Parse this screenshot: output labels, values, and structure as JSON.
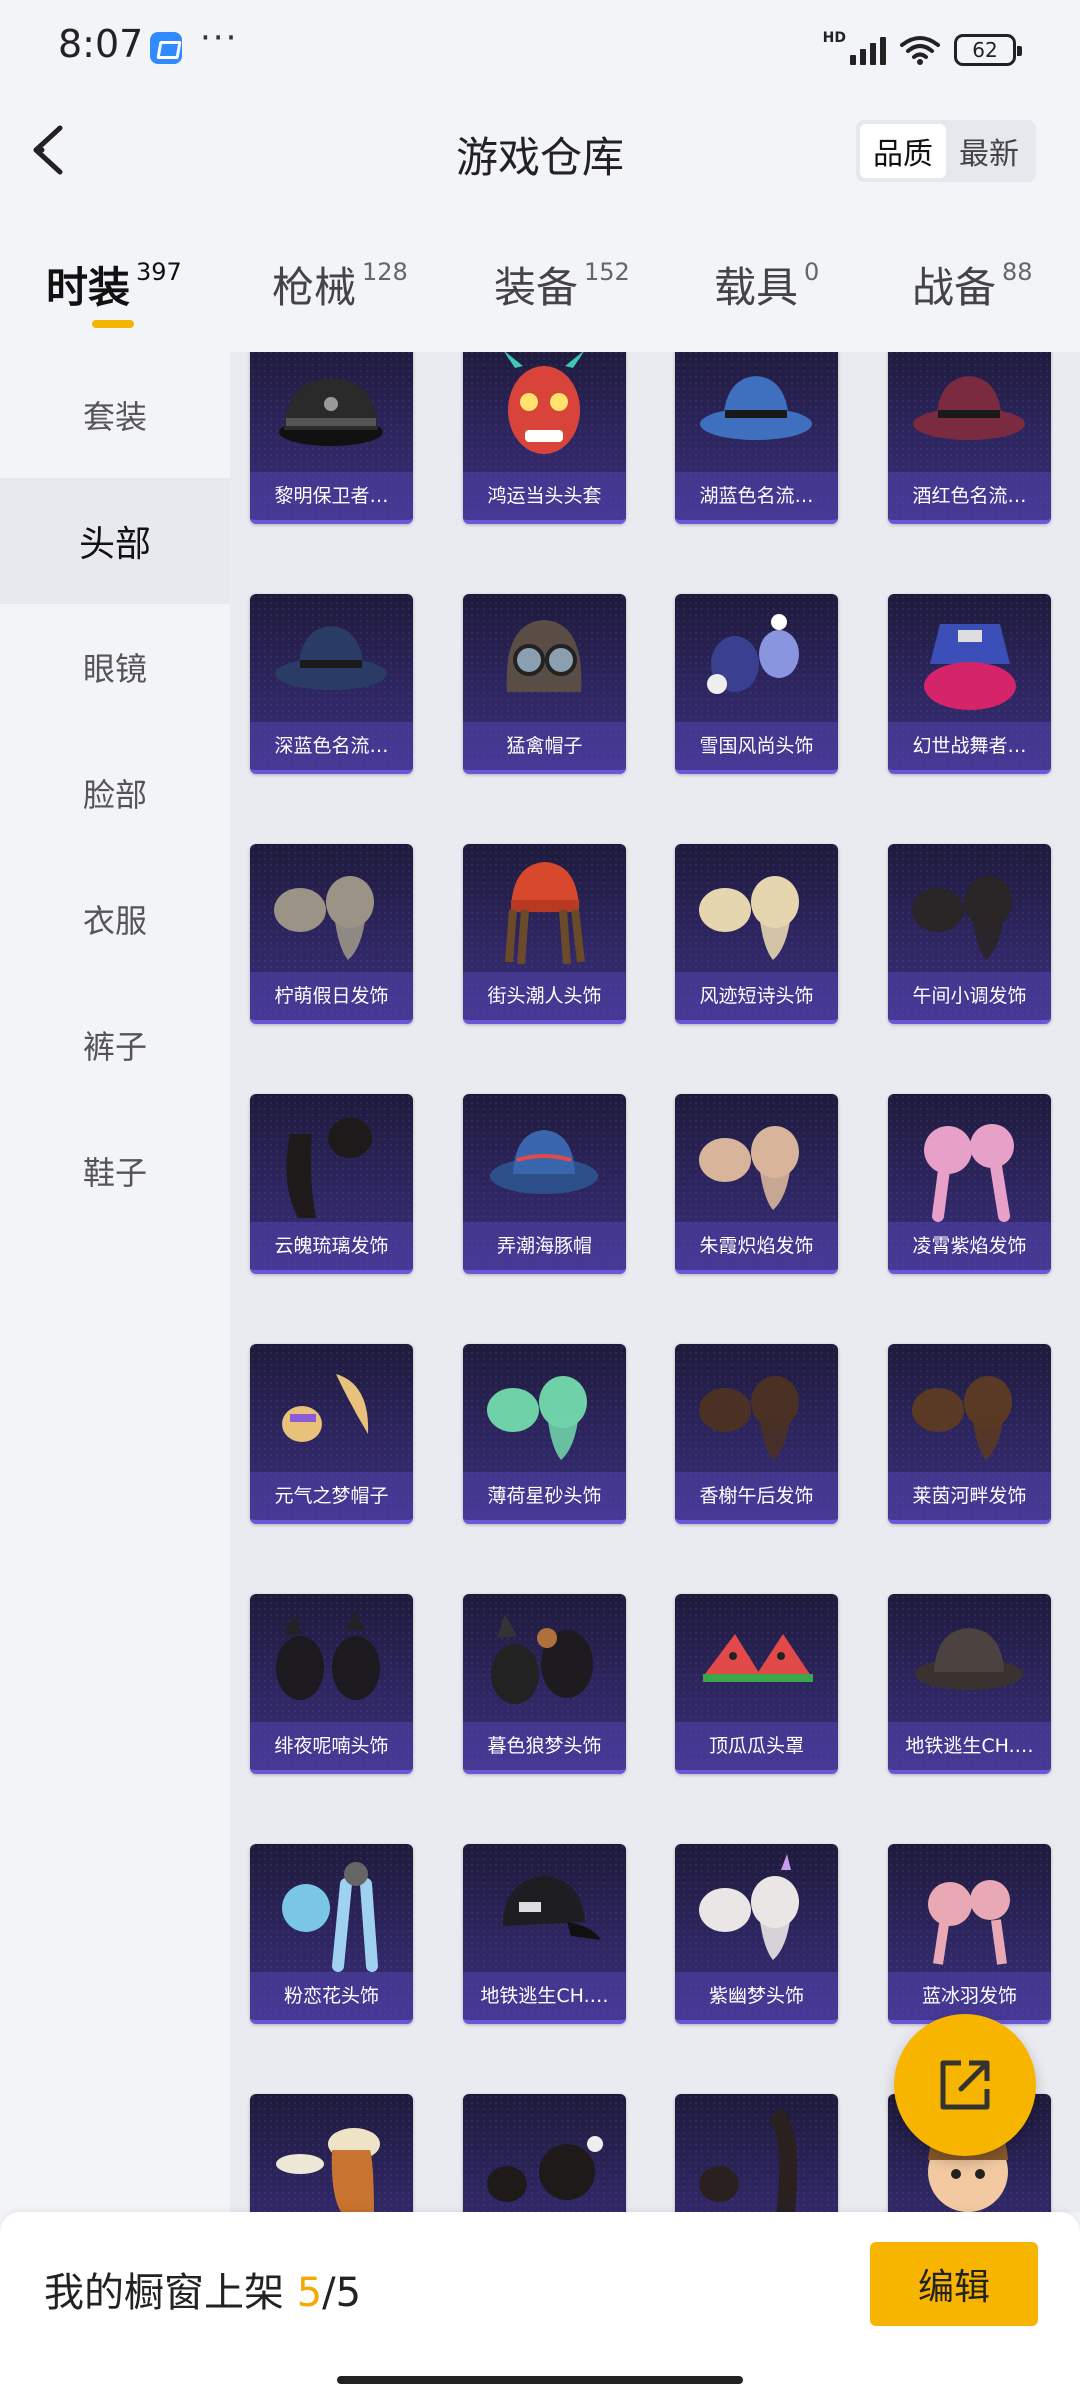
{
  "status": {
    "time": "8:07",
    "more": "···",
    "network": "HD",
    "battery": "62"
  },
  "header": {
    "title": "游戏仓库",
    "sort_options": [
      "品质",
      "最新"
    ],
    "active_sort": "品质"
  },
  "tabs": [
    {
      "label": "时装",
      "count": "397",
      "active": true
    },
    {
      "label": "枪械",
      "count": "128",
      "active": false
    },
    {
      "label": "装备",
      "count": "152",
      "active": false
    },
    {
      "label": "载具",
      "count": "0",
      "active": false
    },
    {
      "label": "战备",
      "count": "88",
      "active": false
    }
  ],
  "sidebar": {
    "items": [
      {
        "label": "套装",
        "active": false
      },
      {
        "label": "头部",
        "active": true
      },
      {
        "label": "眼镜",
        "active": false
      },
      {
        "label": "脸部",
        "active": false
      },
      {
        "label": "衣服",
        "active": false
      },
      {
        "label": "裤子",
        "active": false
      },
      {
        "label": "鞋子",
        "active": false
      }
    ]
  },
  "items": [
    {
      "name": "黎明保卫者…",
      "art": "peaked-cap"
    },
    {
      "name": "鸿运当头头套",
      "art": "dragon-mask"
    },
    {
      "name": "湖蓝色名流…",
      "art": "blue-fedora"
    },
    {
      "name": "酒红色名流…",
      "art": "red-fedora"
    },
    {
      "name": "深蓝色名流…",
      "art": "navy-fedora"
    },
    {
      "name": "猛禽帽子",
      "art": "aviator-helmet"
    },
    {
      "name": "雪国风尚头饰",
      "art": "snow-headwear"
    },
    {
      "name": "幻世战舞者…",
      "art": "bucket-hat-pink-hair"
    },
    {
      "name": "柠萌假日发饰",
      "art": "gray-hair"
    },
    {
      "name": "街头潮人头饰",
      "art": "beanie-dreads"
    },
    {
      "name": "风迹短诗头饰",
      "art": "blonde-hair"
    },
    {
      "name": "午间小调发饰",
      "art": "black-hair"
    },
    {
      "name": "云魄琉璃发饰",
      "art": "long-black-hair"
    },
    {
      "name": "弄潮海豚帽",
      "art": "blue-bucket-hat"
    },
    {
      "name": "朱霞炽焰发饰",
      "art": "strawberry-blonde-hair"
    },
    {
      "name": "凌霄紫焰发饰",
      "art": "pink-twintails"
    },
    {
      "name": "元气之梦帽子",
      "art": "blonde-ponytail"
    },
    {
      "name": "薄荷星砂头饰",
      "art": "mint-hair"
    },
    {
      "name": "香榭午后发饰",
      "art": "brown-hair"
    },
    {
      "name": "莱茵河畔发饰",
      "art": "brown-bob"
    },
    {
      "name": "绯夜呢喃头饰",
      "art": "dark-hair-ears"
    },
    {
      "name": "暮色狼梦头饰",
      "art": "wolf-ears-hair"
    },
    {
      "name": "顶瓜瓜头罩",
      "art": "watermelon-hat"
    },
    {
      "name": "地铁逃生CH.…",
      "art": "leather-bucket-hat"
    },
    {
      "name": "粉恋花头饰",
      "art": "blue-braids"
    },
    {
      "name": "地铁逃生CH.…",
      "art": "black-cap"
    },
    {
      "name": "紫幽梦头饰",
      "art": "white-hair"
    },
    {
      "name": "蓝冰羽发饰",
      "art": "pink-buns"
    },
    {
      "name": "",
      "art": "beret-hair"
    },
    {
      "name": "",
      "art": "black-bun-hair"
    },
    {
      "name": "",
      "art": "braided-hair"
    },
    {
      "name": "",
      "art": "cartoon-head"
    }
  ],
  "bottom": {
    "label": "我的橱窗上架",
    "current": "5",
    "total": "/5",
    "edit_label": "编辑"
  },
  "colors": {
    "accent": "#f7b500",
    "card_bg": "#2e2660",
    "card_label_bg": "#5042aa"
  }
}
